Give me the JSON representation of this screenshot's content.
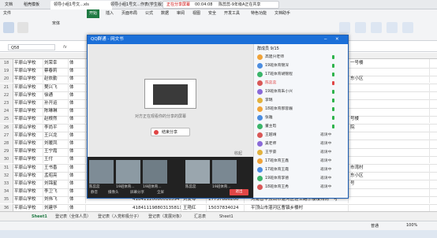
{
  "tabs": {
    "wps_label": "文档",
    "template_label": "稻壳模板",
    "file_label": "领导小组1号文...xls",
    "tab2_label": "领导小组1号文...作表(学生版)",
    "share_status": "正在分享屏幕",
    "share_time": "00:04:08",
    "share_group": "陈蕊蕊-9年级A正在共享"
  },
  "ribbon": {
    "file_menu": "文件",
    "start": "开始",
    "insert": "插入",
    "page_layout": "页面布局",
    "formula": "公式",
    "data": "数据",
    "review": "审阅",
    "view": "视图",
    "security": "安全",
    "dev_tools": "开发工具",
    "special": "特色功能",
    "doc_assist": "文档助手",
    "font_name": "宋体"
  },
  "formula_bar": {
    "name_box": "Q58",
    "fx": "fx"
  },
  "sheet": {
    "rows": [
      {
        "num": "18",
        "school": "平原山学校",
        "name": "刘荣幸",
        "sex": "体"
      },
      {
        "num": "19",
        "school": "平原山学校",
        "name": "蔡春莉",
        "sex": "体"
      },
      {
        "num": "20",
        "school": "平原山学校",
        "name": "赵依勤",
        "sex": "体"
      },
      {
        "num": "21",
        "school": "平原山学校",
        "name": "樊兴飞",
        "sex": "体"
      },
      {
        "num": "22",
        "school": "平原山学校",
        "name": "徐通",
        "sex": "体"
      },
      {
        "num": "23",
        "school": "平原山学校",
        "name": "孙开运",
        "sex": "体"
      },
      {
        "num": "24",
        "school": "平原山学校",
        "name": "陈琳琳",
        "sex": "体"
      },
      {
        "num": "25",
        "school": "平原山学校",
        "name": "赵根然",
        "sex": "体"
      },
      {
        "num": "26",
        "school": "平原山学校",
        "name": "李尚平",
        "sex": "体"
      },
      {
        "num": "27",
        "school": "平原山学校",
        "name": "王兴龙",
        "sex": "体"
      },
      {
        "num": "28",
        "school": "平原山学校",
        "name": "刘暖凤",
        "sex": "体"
      },
      {
        "num": "29",
        "school": "平原山学校",
        "name": "王宁霞",
        "sex": "体"
      },
      {
        "num": "30",
        "school": "平原山学校",
        "name": "王付",
        "sex": "体"
      },
      {
        "num": "31",
        "school": "平原山学校",
        "name": "王书香",
        "sex": "体"
      },
      {
        "num": "32",
        "school": "平原山学校",
        "name": "孟昭亮",
        "sex": "体"
      },
      {
        "num": "33",
        "school": "平原山学校",
        "name": "刘锦星",
        "sex": "体"
      },
      {
        "num": "34",
        "school": "平原山学校",
        "name": "李卫飞",
        "sex": "体"
      },
      {
        "num": "35",
        "school": "平原山学校",
        "name": "刘伟飞",
        "sex": "体"
      },
      {
        "num": "36",
        "school": "平原山学校",
        "name": "刘建华",
        "sex": "体"
      }
    ],
    "right_col": [
      "一号楼",
      "",
      "东小区",
      "",
      "",
      "",
      "",
      "号楼",
      "院",
      "",
      "",
      "",
      "",
      "市湾村",
      "东小区",
      "号",
      "",
      "",
      ""
    ],
    "row35_extra": {
      "id": "41841120080016594",
      "name2": "刘爱琴",
      "phone": "17737886200",
      "addr": "河南省平顶山市湛河区轻工路东楼楼排附一号"
    },
    "row36_extra": {
      "id": "41841119880313581X",
      "name2": "王艳红",
      "phone": "15037834024",
      "addr": "平顶山市湛河区曹镇乡楼村"
    }
  },
  "sheet_tabs": [
    "Sheet1",
    "登记表（全体人员）",
    "登记表（入党积极分子）",
    "登记表（发展对象）",
    "汇总表",
    "Sheet1"
  ],
  "status": {
    "zoom": "100%",
    "mode": "普通"
  },
  "qq": {
    "title": "QQ群通 - 网文书",
    "members_title": "群成员 9/15",
    "share_hint": "对方正在观看你的分享的屏幕",
    "end_share": "结束分享",
    "collapse": "收起",
    "members": [
      {
        "name": "高建兴老师",
        "status": "",
        "mic": "on"
      },
      {
        "name": "19班体育锦深",
        "status": "",
        "mic": "on"
      },
      {
        "name": "17班体育胡锦程",
        "status": "",
        "mic": "on"
      },
      {
        "name": "陈蕊蕊",
        "status": "",
        "mic": "off"
      },
      {
        "name": "19班体育朱小兴",
        "status": "",
        "mic": "on"
      },
      {
        "name": "李璐",
        "status": "",
        "mic": "on"
      },
      {
        "name": "18班体育郝蓉巍",
        "status": "",
        "mic": "on"
      },
      {
        "name": "张雅",
        "status": "",
        "mic": "on"
      },
      {
        "name": "董主晗",
        "status": "",
        "mic": "on"
      },
      {
        "name": "王越靖",
        "status": "邀请中",
        "mic": "none"
      },
      {
        "name": "吴老师",
        "status": "邀请中",
        "mic": "none"
      },
      {
        "name": "王宇豪",
        "status": "邀请中",
        "mic": "none"
      },
      {
        "name": "17班体育王鑫",
        "status": "邀请中",
        "mic": "none"
      },
      {
        "name": "17班体育王霞",
        "status": "邀请中",
        "mic": "none"
      },
      {
        "name": "19班体育李德",
        "status": "邀请中",
        "mic": "none"
      },
      {
        "name": "18班体育王秀",
        "status": "邀请中",
        "mic": "none"
      }
    ],
    "video_labels": [
      "陈蕊蕊",
      "19班体育...",
      "19班体育...",
      "陈蕊蕊",
      "19班体育..."
    ],
    "controls": {
      "mute": "静音",
      "camera": "摄像头",
      "screen": "屏幕分享",
      "all": "全屏",
      "hangup": "退出"
    }
  }
}
